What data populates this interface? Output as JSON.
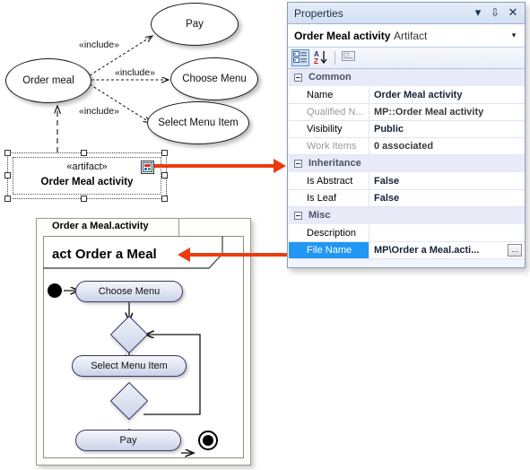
{
  "usecase_diagram": {
    "actor_usecase": "Order meal",
    "usecases": [
      {
        "label": "Pay"
      },
      {
        "label": "Choose Menu"
      },
      {
        "label": "Select Menu Item"
      }
    ],
    "include_labels": [
      "«include»",
      "«include»",
      "«include»"
    ],
    "artifact": {
      "stereotype": "«artifact»",
      "name": "Order Meal activity",
      "icon": "artifact-file-icon"
    }
  },
  "activity_diagram": {
    "tab_label": "Order a Meal.activity",
    "frame_title": "act Order a Meal",
    "nodes": [
      {
        "label": "Choose Menu"
      },
      {
        "label": "Select Menu Item"
      },
      {
        "label": "Pay"
      }
    ]
  },
  "properties_panel": {
    "title": "Properties",
    "window_buttons": {
      "dropdown": "▾",
      "pin": "⇩",
      "close": "✕"
    },
    "selected_object": {
      "name": "Order Meal activity",
      "type": "Artifact",
      "caret": "▾"
    },
    "toolbar": {
      "categorized_label": "categorized-view-icon",
      "alphabetical_label": "alphabetical-sort-icon",
      "property_pages_label": "property-pages-icon"
    },
    "categories": [
      {
        "name": "Common",
        "rows": [
          {
            "name": "Name",
            "value": "Order Meal activity",
            "dim_name": false,
            "selected": false,
            "has_browse": false
          },
          {
            "name": "Qualified N...",
            "value": "MP::Order Meal activity",
            "dim_name": true,
            "selected": false,
            "has_browse": false
          },
          {
            "name": "Visibility",
            "value": "Public",
            "dim_name": false,
            "selected": false,
            "has_browse": false
          },
          {
            "name": "Work Items",
            "value": "0 associated",
            "dim_name": true,
            "selected": false,
            "has_browse": false
          }
        ]
      },
      {
        "name": "Inheritance",
        "rows": [
          {
            "name": "Is Abstract",
            "value": "False",
            "dim_name": false,
            "selected": false,
            "has_browse": false
          },
          {
            "name": "Is Leaf",
            "value": "False",
            "dim_name": false,
            "selected": false,
            "has_browse": false
          }
        ]
      },
      {
        "name": "Misc",
        "rows": [
          {
            "name": "Description",
            "value": "",
            "dim_name": false,
            "selected": false,
            "has_browse": false
          },
          {
            "name": "File Name",
            "value": "MP\\Order a Meal.acti...",
            "dim_name": false,
            "selected": true,
            "has_browse": true,
            "browse_label": "..."
          }
        ]
      }
    ]
  },
  "annotations": {
    "arrow_color": "#ea3c10",
    "arrow_to_properties": "artifact-to-properties-arrow",
    "arrow_to_activity": "filename-to-activity-arrow"
  }
}
